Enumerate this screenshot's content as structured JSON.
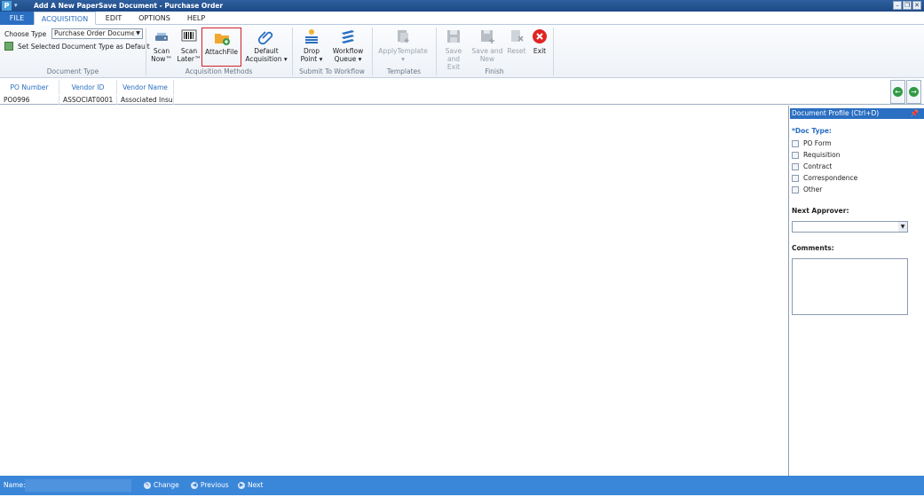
{
  "window": {
    "title": "Add A New PaperSave Document - Purchase Order",
    "app_letter": "P"
  },
  "tabs": {
    "file": "FILE",
    "acquisition": "ACQUISITION",
    "edit": "EDIT",
    "options": "OPTIONS",
    "help": "HELP"
  },
  "document_type": {
    "choose_label": "Choose Type",
    "selected": "Purchase Order Docume",
    "set_default": "Set Selected Document Type as Default",
    "group": "Document Type"
  },
  "acquisition_methods": {
    "scan_now": [
      "Scan",
      "Now™"
    ],
    "scan_later": [
      "Scan",
      "Later™"
    ],
    "attach_file": "AttachFile",
    "default_acq": [
      "Default",
      "Acquisition ▾"
    ],
    "group": "Acquisition Methods"
  },
  "workflow": {
    "drop_point": [
      "Drop",
      "Point ▾"
    ],
    "workflow_queue": [
      "Workflow",
      "Queue ▾"
    ],
    "group": "Submit To Workflow"
  },
  "templates": {
    "apply": [
      "ApplyTemplate",
      "▾"
    ],
    "group": "Templates"
  },
  "finish": {
    "save_exit": [
      "Save",
      "and Exit"
    ],
    "save_new": [
      "Save and",
      "New"
    ],
    "reset": "Reset",
    "exit": "Exit",
    "group": "Finish"
  },
  "grid": {
    "headers": [
      "PO Number",
      "Vendor ID",
      "Vendor Name"
    ],
    "row": [
      "PO0996",
      "ASSOCIAT0001",
      "Associated Insura"
    ]
  },
  "panel": {
    "title": "Document Profile (Ctrl+D)",
    "doc_type_label": "*Doc Type:",
    "doc_types": [
      "PO Form",
      "Requisition",
      "Contract",
      "Correspondence",
      "Other"
    ],
    "next_approver": "Next Approver:",
    "comments": "Comments:"
  },
  "status": {
    "name_label": "Name:",
    "change": "Change",
    "previous": "Previous",
    "next": "Next"
  },
  "colors": {
    "accent": "#2b6fc2",
    "status_bar": "#3a86d9",
    "highlight": "#d0202a"
  }
}
